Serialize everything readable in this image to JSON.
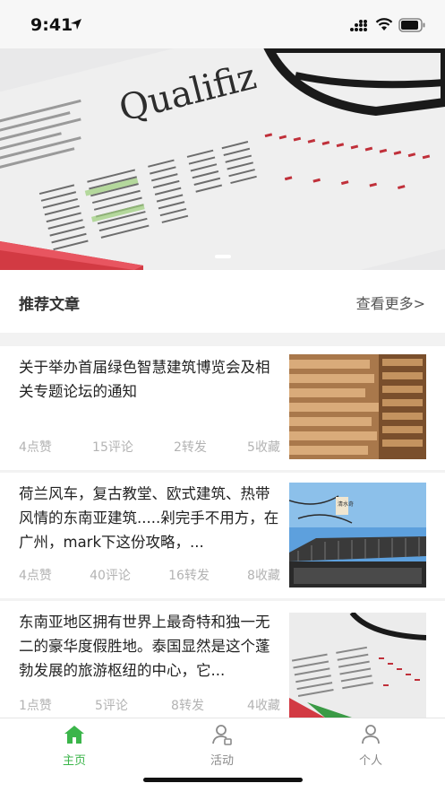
{
  "status_bar": {
    "time": "9:41",
    "icons": [
      "location-arrow-icon",
      "signal-icon",
      "wifi-icon",
      "battery-icon"
    ]
  },
  "banner": {
    "image": "newspaper stock page with glasses and red pencil",
    "printed_text": "Qualifiz",
    "page_indicator_active": 1
  },
  "section": {
    "title": "推荐文章",
    "more_label": "查看更多>"
  },
  "articles": [
    {
      "title": "关于举办首届绿色智慧建筑博览会及相关专题论坛的通知",
      "likes": "4点赞",
      "comments": "15评论",
      "shares": "2转发",
      "favorites": "5收藏",
      "thumbnail": "stacked wooden planks"
    },
    {
      "title": "荷兰风车，复古教堂、欧式建筑、热带风情的东南亚建筑.....剁完手不用方，在广州，mark下这份攻略，...",
      "likes": "4点赞",
      "comments": "40评论",
      "shares": "16转发",
      "favorites": "8收藏",
      "thumbnail": "traditional chinese roof under blue sky",
      "thumb_text": "清水奇"
    },
    {
      "title": "东南亚地区拥有世界上最奇特和独一无二的豪华度假胜地。泰国显然是这个蓬勃发展的旅游枢纽的中心，它...",
      "likes": "1点赞",
      "comments": "5评论",
      "shares": "8转发",
      "favorites": "4收藏",
      "thumbnail": "newspaper stock page with glasses"
    }
  ],
  "tab_bar": {
    "tabs": [
      {
        "label": "主页",
        "icon": "home-icon",
        "active": true
      },
      {
        "label": "活动",
        "icon": "activity-person-icon",
        "active": false
      },
      {
        "label": "个人",
        "icon": "profile-person-icon",
        "active": false
      }
    ],
    "active_color": "#3bb54a",
    "inactive_color": "#8a8a8a"
  }
}
